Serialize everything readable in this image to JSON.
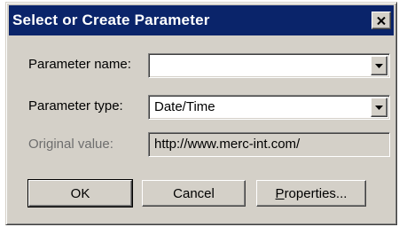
{
  "dialog": {
    "title": "Select or Create Parameter",
    "close_icon": "close-icon"
  },
  "fields": {
    "parameter_name": {
      "label": "Parameter name:",
      "value": ""
    },
    "parameter_type": {
      "label": "Parameter type:",
      "value": "Date/Time"
    },
    "original_value": {
      "label": "Original value:",
      "value": "http://www.merc-int.com/"
    }
  },
  "buttons": {
    "ok": "OK",
    "cancel": "Cancel",
    "properties": "Properties..."
  },
  "colors": {
    "title_bar": "#0a246a",
    "dialog_face": "#d4d0c8"
  }
}
